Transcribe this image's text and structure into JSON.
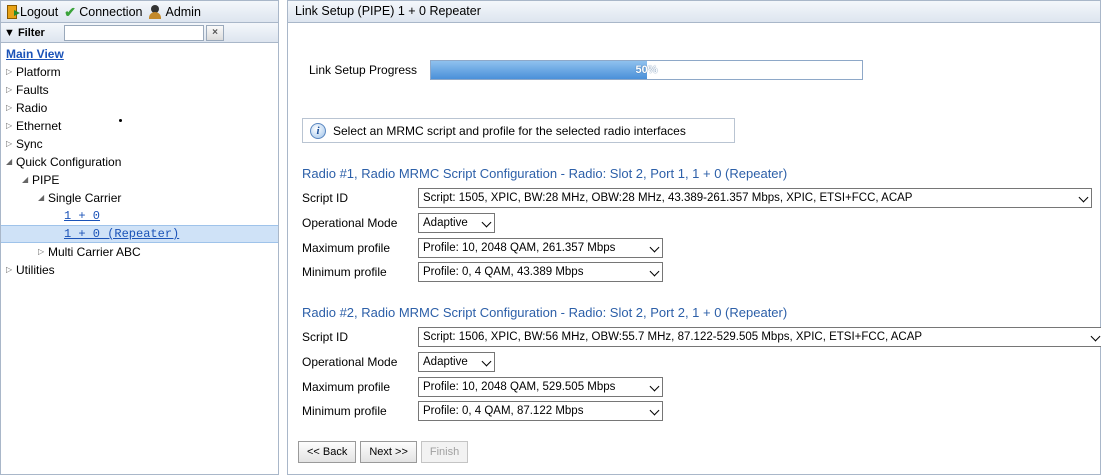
{
  "topbar": {
    "logout_label": "Logout",
    "connection_label": "Connection",
    "admin_label": "Admin"
  },
  "filter": {
    "label": "▼ Filter",
    "value": "",
    "clear_label": "×"
  },
  "tree": {
    "main_view": "Main View",
    "platform": "Platform",
    "faults": "Faults",
    "radio": "Radio",
    "ethernet": "Ethernet",
    "sync": "Sync",
    "quick_configuration": "Quick Configuration",
    "pipe": "PIPE",
    "single_carrier": "Single Carrier",
    "one_plus_zero": "1 + 0",
    "one_plus_zero_repeater": "1 + 0 (Repeater)",
    "multi_carrier_abc": "Multi Carrier ABC",
    "utilities": "Utilities"
  },
  "page_title": "Link Setup (PIPE) 1 + 0 Repeater",
  "progress": {
    "label": "Link Setup Progress",
    "percent": 50,
    "text": "50%"
  },
  "info_message": "Select an MRMC script and profile for the selected radio interfaces",
  "radios": [
    {
      "title": "Radio #1, Radio MRMC Script Configuration - Radio: Slot 2, Port 1, 1 + 0 (Repeater)",
      "script_id_label": "Script ID",
      "script_id_value": "Script: 1505, XPIC, BW:28 MHz, OBW:28 MHz, 43.389-261.357 Mbps, XPIC, ETSI+FCC, ACAP",
      "op_mode_label": "Operational Mode",
      "op_mode_value": "Adaptive",
      "max_profile_label": "Maximum profile",
      "max_profile_value": "Profile: 10, 2048 QAM, 261.357 Mbps",
      "min_profile_label": "Minimum profile",
      "min_profile_value": "Profile: 0, 4 QAM, 43.389 Mbps"
    },
    {
      "title": "Radio #2, Radio MRMC Script Configuration - Radio: Slot 2, Port 2, 1 + 0 (Repeater)",
      "script_id_label": "Script ID",
      "script_id_value": "Script: 1506, XPIC, BW:56 MHz, OBW:55.7 MHz, 87.122-529.505 Mbps, XPIC, ETSI+FCC, ACAP",
      "op_mode_label": "Operational Mode",
      "op_mode_value": "Adaptive",
      "max_profile_label": "Maximum profile",
      "max_profile_value": "Profile: 10, 2048 QAM, 529.505 Mbps",
      "min_profile_label": "Minimum profile",
      "min_profile_value": "Profile: 0, 4 QAM, 87.122 Mbps"
    }
  ],
  "buttons": {
    "back": "<< Back",
    "next": "Next >>",
    "finish": "Finish"
  },
  "colors": {
    "section_title": "#2c5fa8",
    "link": "#1b53b8",
    "progress_fill": "#4a90d9",
    "selected_row": "#cfe2f7"
  }
}
